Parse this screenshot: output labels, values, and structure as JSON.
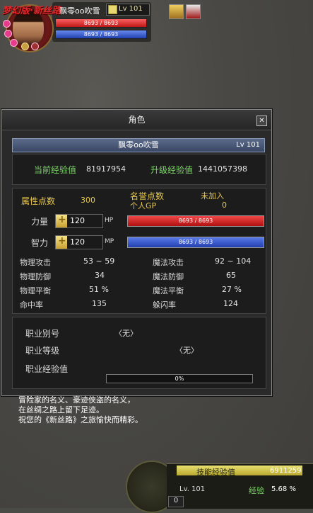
{
  "hud": {
    "logo": "梦幻版·新丝路",
    "name": "飘零oo吹雪",
    "level": "Lv 101",
    "hp": "8693 / 8693",
    "mp": "8693 / 8693"
  },
  "window": {
    "title": "角色",
    "close": "✕",
    "char_name": "飘零oo吹雪",
    "char_level": "Lv 101",
    "exp_label": "当前经验值",
    "exp_value": "81917954",
    "next_exp_label": "升级经验值",
    "next_exp_value": "1441057398",
    "attr_points_label": "属性点数",
    "attr_points_value": "300",
    "honor_label": "名誉点数",
    "honor_value": "未加入",
    "gp_label": "个人GP",
    "gp_value": "0",
    "str_label": "力量",
    "str_value": "120",
    "int_label": "智力",
    "int_value": "120",
    "hp_tag": "HP",
    "mp_tag": "MP",
    "hp_text": "8693 / 8693",
    "mp_text": "8693 / 8693",
    "stats": {
      "phys_atk_label": "物理攻击",
      "phys_atk_value": "53 ~ 59",
      "mag_atk_label": "魔法攻击",
      "mag_atk_value": "92 ~ 104",
      "phys_def_label": "物理防御",
      "phys_def_value": "34",
      "mag_def_label": "魔法防御",
      "mag_def_value": "65",
      "phys_bal_label": "物理平衡",
      "phys_bal_value": "51 %",
      "mag_bal_label": "魔法平衡",
      "mag_bal_value": "27 %",
      "hit_label": "命中率",
      "hit_value": "135",
      "dodge_label": "躲闪率",
      "dodge_value": "124"
    },
    "job": {
      "alias_label": "职业别号",
      "alias_value": "〈无〉",
      "level_label": "职业等级",
      "level_value": "〈无〉",
      "exp_label": "职业经验值",
      "exp_value": "0%"
    }
  },
  "chat": {
    "line1": "冒险家的名义、豪迹侠盗的名义，",
    "line2": "在丝绸之路上留下足迹。",
    "line3": "祝您的《新丝路》之旅愉快而精彩。"
  },
  "bottom": {
    "skill_exp_label": "技能经验值",
    "skill_exp_value": "6911259",
    "level": "Lv. 101",
    "exp_label": "经验",
    "exp_percent": "5.68 %",
    "input_value": "0"
  },
  "colors": {
    "gold": "#e8c84a",
    "green": "#7ed86a",
    "hp": "#c01818",
    "mp": "#2040b0"
  }
}
